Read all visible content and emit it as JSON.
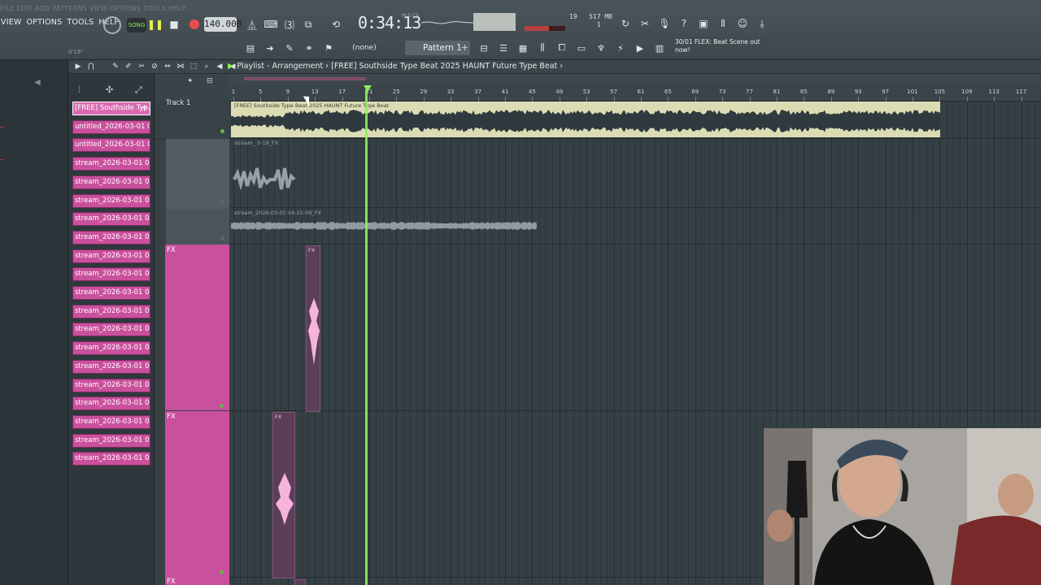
{
  "menu": [
    "FILE",
    "EDIT",
    "ADD",
    "PATTERNS",
    "VIEW",
    "OPTIONS",
    "TOOLS",
    "HELP"
  ],
  "visible_menu": [
    "VIEW",
    "OPTIONS",
    "TOOLS",
    "HELP"
  ],
  "transport": {
    "mode": "SONG",
    "tempo": "140.000",
    "time": "0:34:13",
    "time_units": "M:S:CS",
    "small_time": "0'19\"",
    "cpu": "19",
    "memory": "517 MB",
    "poly": "1"
  },
  "snap": "(none)",
  "pattern": "Pattern 1",
  "news": "30/01  FLEX: Beat Scene out now!",
  "playlist": {
    "title": "Playlist - Arrangement",
    "separator": "›",
    "song": "[FREE] Southside Type Beat 2025 HAUNT Future Type Beat",
    "track1_name": "Track 1",
    "fx_label": "FX"
  },
  "clips": [
    "[FREE] Southside Typ...",
    "untitled_2026-03-01 04-...",
    "untitled_2026-03-01 04-...",
    "stream_2026-03-01 04-...",
    "stream_2026-03-01 04-...",
    "stream_2026-03-01 04-...",
    "stream_2026-03-01 04-...",
    "stream_2026-03-01 04-...",
    "stream_2026-03-01 04-...",
    "stream_2026-03-01 04-...",
    "stream_2026-03-01 04-...",
    "stream_2026-03-01 04-...",
    "stream_2026-03-01 04-...",
    "stream_2026-03-01 04-...",
    "stream_2026-03-01 04-...",
    "stream_2026-03-01 04-...",
    "stream_2026-03-01 04-...",
    "stream_2026-03-01 04-...",
    "stream_2026-03-01 04-...",
    "stream_2026-03-01 04-..."
  ],
  "ruler_ticks": [
    "1",
    "5",
    "9",
    "13",
    "17",
    "21",
    "25",
    "29",
    "33",
    "37",
    "41",
    "45",
    "49",
    "53",
    "57",
    "61",
    "65",
    "69",
    "73",
    "77",
    "81",
    "85",
    "89",
    "93",
    "97",
    "101",
    "105",
    "109",
    "113",
    "117"
  ],
  "timeline_clips": {
    "main": "[FREE] Southside Type Beat 2025 HAUNT Future Type Beat",
    "stream_a": "stream_  0-18_FX",
    "stream_b": "stream_2026-03-01 04-15-09_FX",
    "fx_a": "FX",
    "fx_b": "FX"
  },
  "colors": {
    "accent_green": "#8ef05b",
    "clip_pink": "#c9509c",
    "main_clip": "#dcdcb4",
    "record_red": "#e84c4c"
  }
}
